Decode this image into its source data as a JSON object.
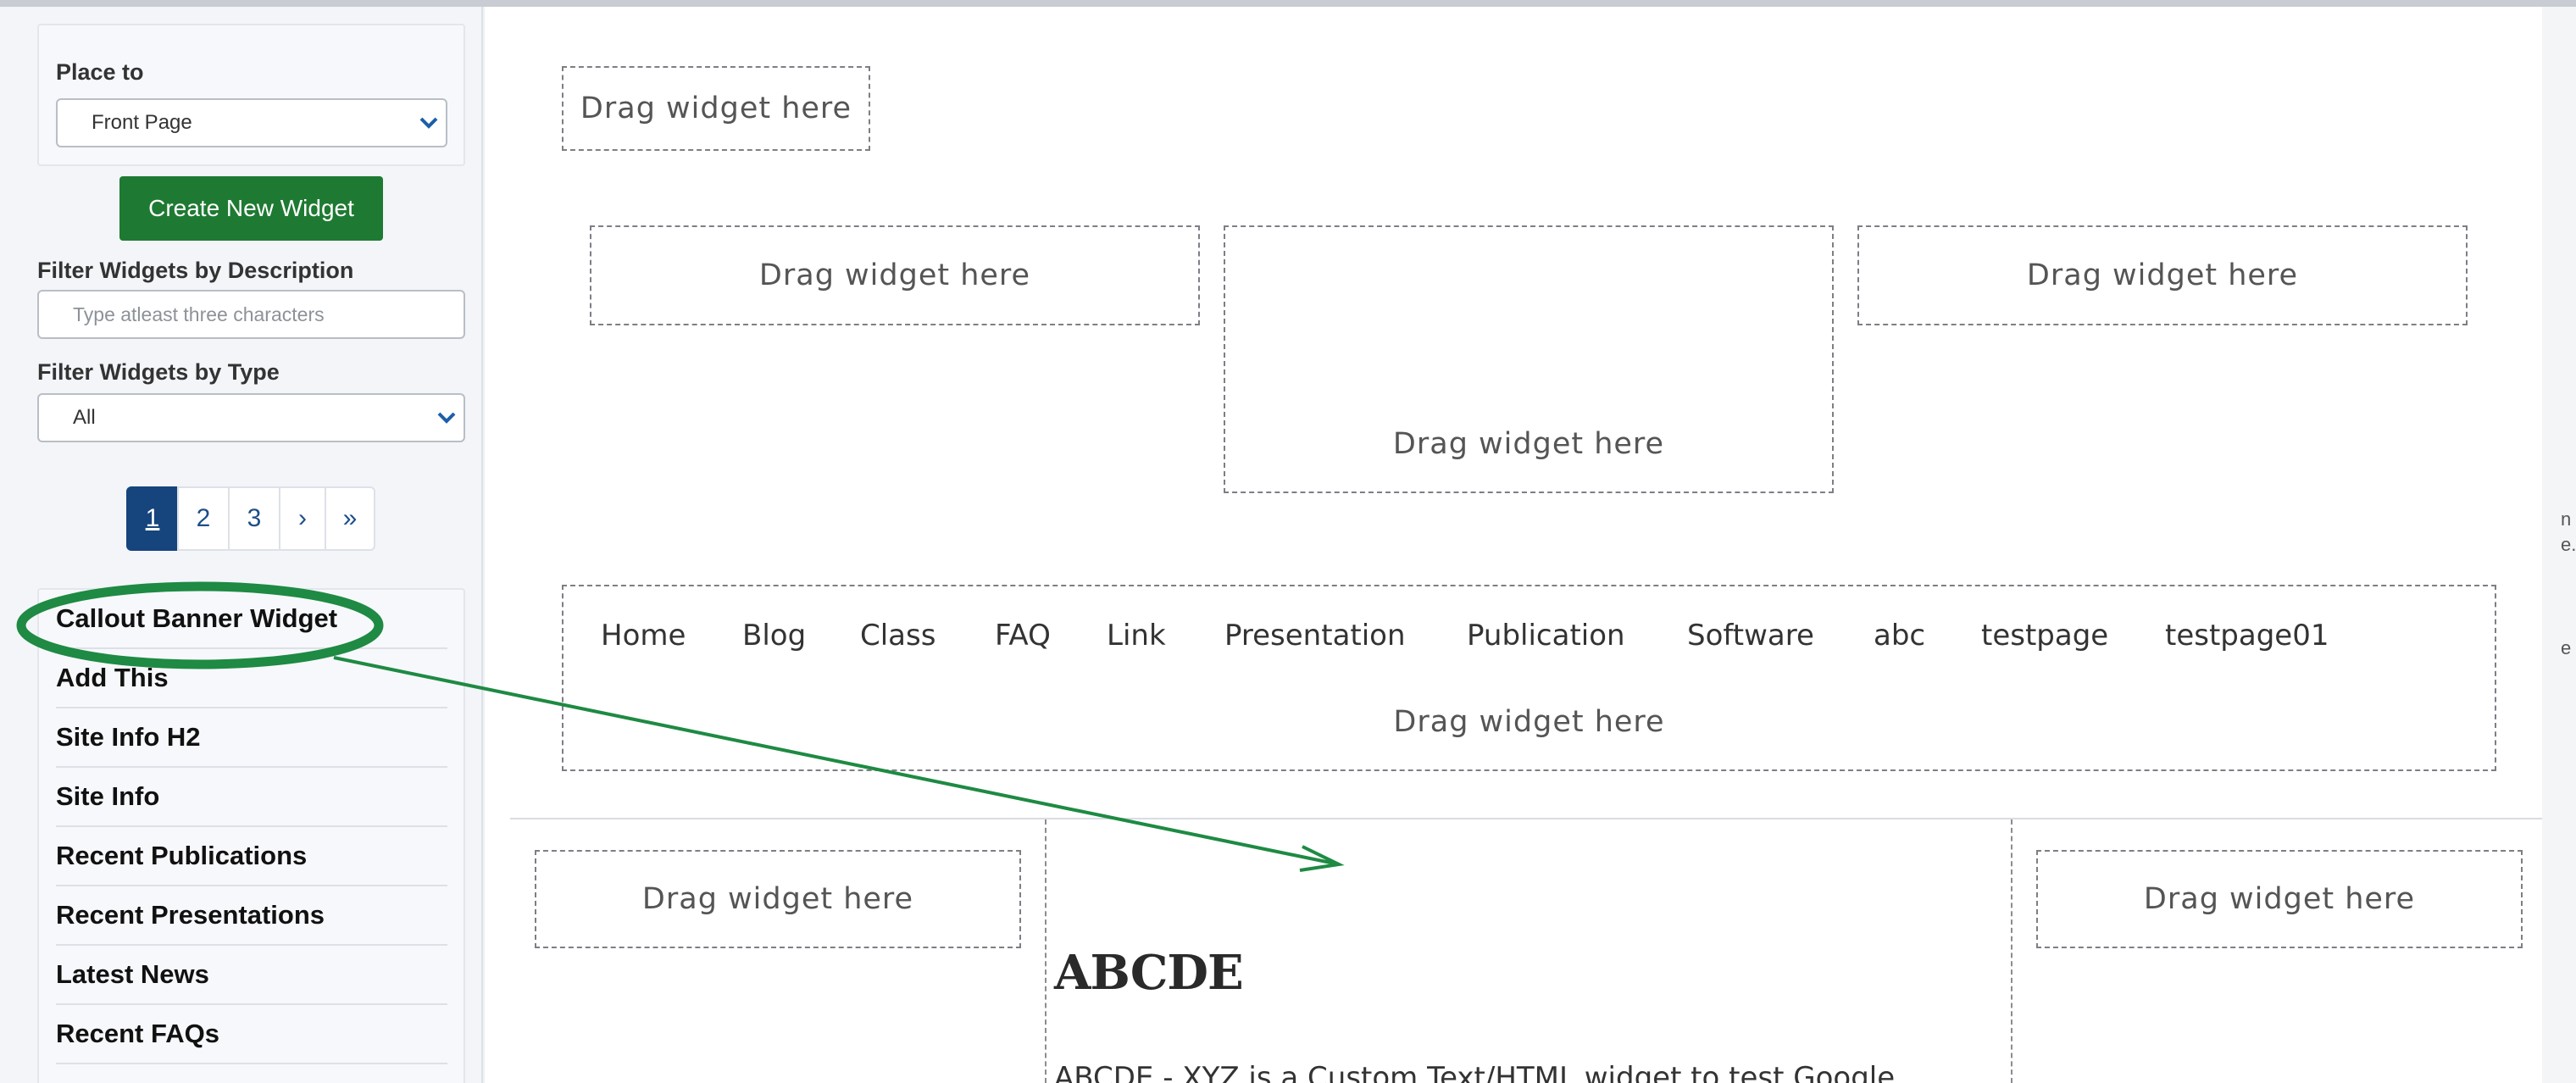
{
  "sidebar": {
    "place_to": {
      "label": "Place to",
      "value": "Front Page"
    },
    "create_button": "Create New Widget",
    "filter_description": {
      "label": "Filter Widgets by Description",
      "placeholder": "Type atleast three characters"
    },
    "filter_type": {
      "label": "Filter Widgets by Type",
      "value": "All"
    },
    "pagination": [
      "1",
      "2",
      "3",
      "›",
      "»"
    ],
    "widgets": [
      "Callout Banner Widget",
      "Add This",
      "Site Info H2",
      "Site Info",
      "Recent Publications",
      "Recent Presentations",
      "Latest News",
      "Recent FAQs"
    ]
  },
  "canvas": {
    "drop_label": "Drag widget here",
    "nav_items": [
      "Home",
      "Blog",
      "Class",
      "FAQ",
      "Link",
      "Presentation",
      "Publication",
      "Software",
      "abc",
      "testpage",
      "testpage01"
    ],
    "content_heading": "ABCDE",
    "content_text": "ABCDE - XYZ is a Custom Text/HTML widget to test Google"
  },
  "edge_fragments": [
    "n",
    "e.",
    "e"
  ],
  "colors": {
    "primary_button": "#1e7a32",
    "pagination_active": "#16457d",
    "annotation": "#1e8a43"
  }
}
